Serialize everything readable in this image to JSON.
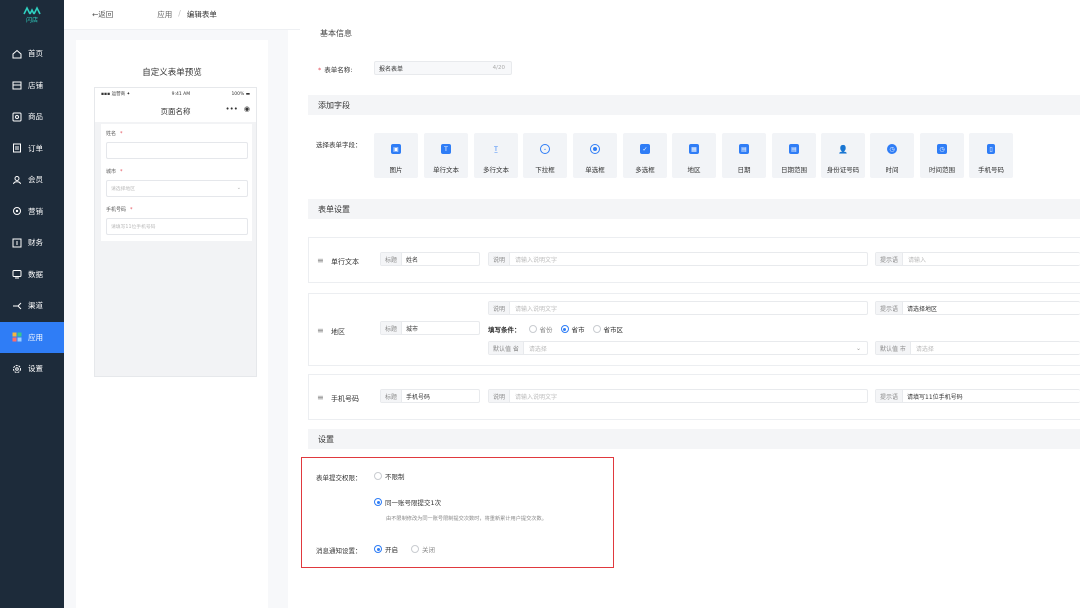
{
  "sidebar": {
    "logo_text": "闪店",
    "items": [
      {
        "label": "首页",
        "icon": "home-icon"
      },
      {
        "label": "店铺",
        "icon": "store-icon"
      },
      {
        "label": "商品",
        "icon": "goods-icon"
      },
      {
        "label": "订单",
        "icon": "order-icon"
      },
      {
        "label": "会员",
        "icon": "member-icon"
      },
      {
        "label": "营销",
        "icon": "marketing-icon"
      },
      {
        "label": "财务",
        "icon": "finance-icon"
      },
      {
        "label": "数据",
        "icon": "data-icon"
      },
      {
        "label": "渠道",
        "icon": "channel-icon"
      },
      {
        "label": "应用",
        "icon": "apps-icon",
        "active": true
      },
      {
        "label": "设置",
        "icon": "settings-icon"
      }
    ]
  },
  "topbar": {
    "back_label": "←返回",
    "breadcrumb": [
      "应用",
      "编辑表单"
    ]
  },
  "preview": {
    "title": "自定义表单预览",
    "status_carrier": "▪▪▪ 运营商 ✦",
    "status_time": "9:41 AM",
    "status_battery": "100% ▬",
    "page_title": "页面名称",
    "fields": [
      {
        "label": "姓名",
        "required": "*",
        "placeholder": ""
      },
      {
        "label": "城市",
        "required": "*",
        "placeholder": "请选择地区",
        "select": true
      },
      {
        "label": "手机号码",
        "required": "*",
        "placeholder": "请填写11位手机号码"
      }
    ]
  },
  "basic": {
    "section_title": "基本信息",
    "name_label": "表单名称:",
    "name_required": "*",
    "name_value": "报名表单",
    "name_count": "4/20"
  },
  "add_fields": {
    "section_title": "添加字段",
    "choose_label": "选择表单字段：",
    "widgets": [
      {
        "label": "图片",
        "icon": "image-icon",
        "glyph": "▣"
      },
      {
        "label": "单行文本",
        "icon": "single-text-icon",
        "glyph": "T"
      },
      {
        "label": "多行文本",
        "icon": "multi-text-icon",
        "glyph": "T"
      },
      {
        "label": "下拉框",
        "icon": "dropdown-icon",
        "glyph": "▾"
      },
      {
        "label": "单选框",
        "icon": "radio-icon",
        "glyph": "◉"
      },
      {
        "label": "多选框",
        "icon": "checkbox-icon",
        "glyph": "✓"
      },
      {
        "label": "地区",
        "icon": "region-icon",
        "glyph": "▦"
      },
      {
        "label": "日期",
        "icon": "date-icon",
        "glyph": "▤"
      },
      {
        "label": "日期范围",
        "icon": "date-range-icon",
        "glyph": "▤"
      },
      {
        "label": "身份证号码",
        "icon": "id-card-icon",
        "glyph": "●"
      },
      {
        "label": "时间",
        "icon": "time-icon",
        "glyph": "◷"
      },
      {
        "label": "时间范围",
        "icon": "time-range-icon",
        "glyph": "◷"
      },
      {
        "label": "手机号码",
        "icon": "phone-icon",
        "glyph": "▯"
      }
    ]
  },
  "form_settings": {
    "section_title": "表单设置",
    "title_prefix": "标题",
    "desc_prefix": "说明",
    "hint_prefix": "提示语",
    "desc_placeholder": "请输入说明文字",
    "single_text": {
      "name": "单行文本",
      "title": "姓名",
      "hint_placeholder": "请输入"
    },
    "region": {
      "name": "地区",
      "title": "城市",
      "hint": "请选择地区",
      "fill_label": "填写条件：",
      "options": [
        "省份",
        "省市",
        "省市区"
      ],
      "selected": "省市",
      "default_prefix": "默认值 省",
      "default_select_placeholder": "请选择",
      "default_city_prefix": "默认值 市",
      "default_city_placeholder": "请选择"
    },
    "phone": {
      "name": "手机号码",
      "title": "手机号码",
      "hint": "请填写11位手机号码"
    }
  },
  "settings": {
    "section_title": "设置",
    "submit_label": "表单提交权限：",
    "opt_unlimited": "不限制",
    "opt_once": "同一账号限提交1次",
    "once_note": "由不限制修改为同一账号限制提交次数时，将重新累计用户提交次数。",
    "notify_label": "消息通知设置：",
    "notify_on": "开启",
    "notify_off": "关闭"
  }
}
